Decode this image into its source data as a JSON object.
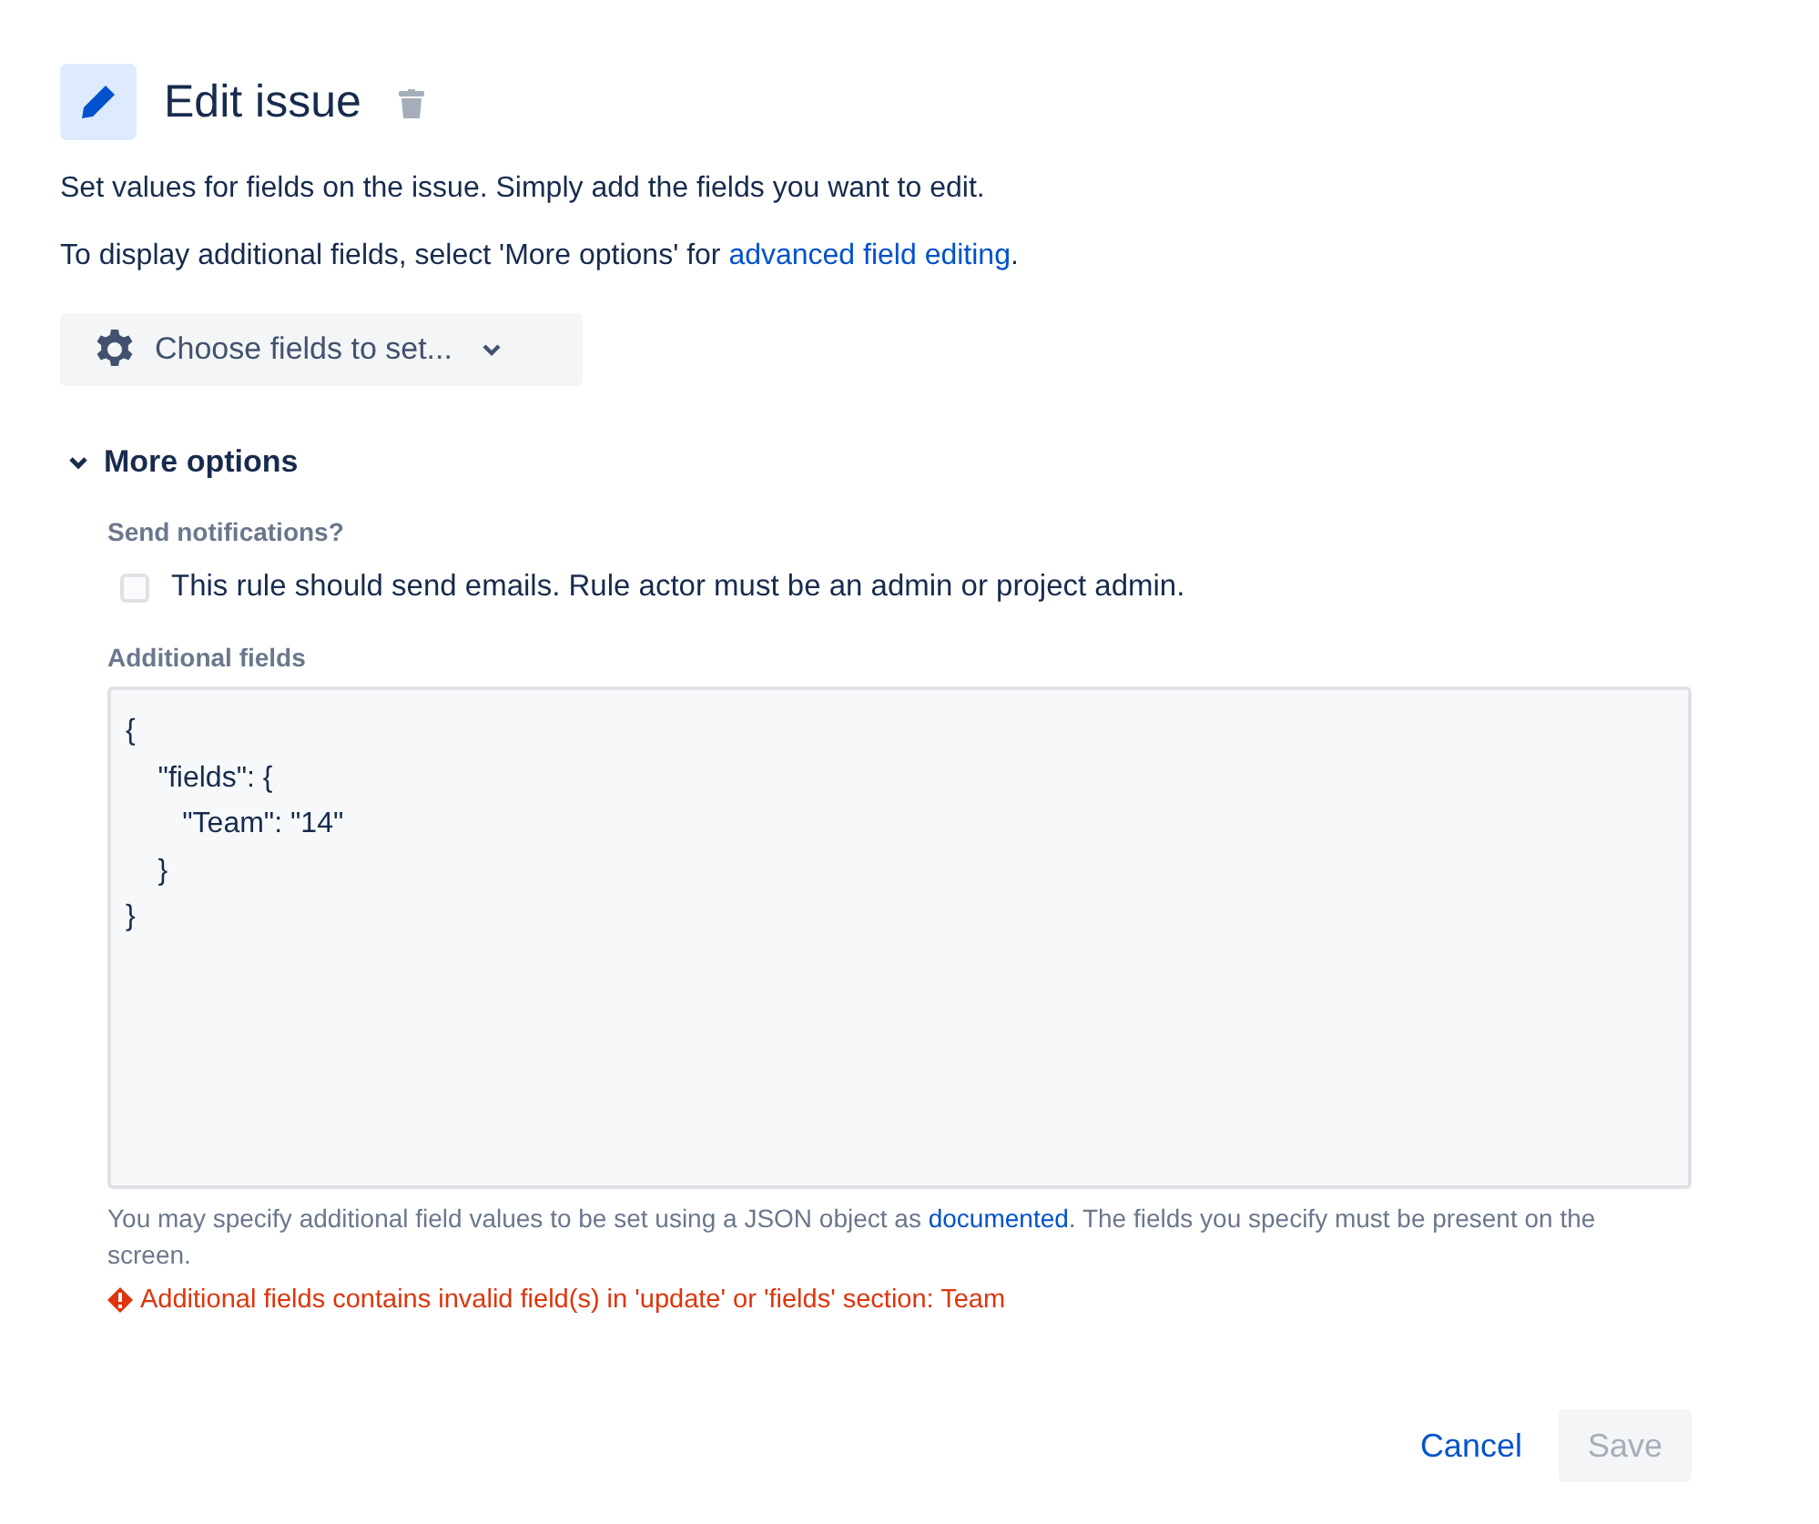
{
  "header": {
    "title": "Edit issue"
  },
  "description": "Set values for fields on the issue. Simply add the fields you want to edit.",
  "advanced_hint": {
    "before": "To display additional fields, select 'More options' for ",
    "link": "advanced field editing",
    "after": "."
  },
  "choose_button": {
    "label": "Choose fields to set..."
  },
  "more_options": {
    "label": "More options",
    "expanded": true,
    "notifications": {
      "label": "Send notifications?",
      "checkbox": {
        "label": "This rule should send emails. Rule actor must be an admin or project admin.",
        "checked": false
      }
    },
    "additional_fields": {
      "label": "Additional fields",
      "value": "{\n    \"fields\": {\n       \"Team\": \"14\"\n    }\n}",
      "help": {
        "before": "You may specify additional field values to be set using a JSON object as ",
        "link": "documented",
        "after": ". The fields you specify must be present on the screen."
      },
      "error": "Additional fields contains invalid field(s) in 'update' or 'fields' section: Team"
    }
  },
  "buttons": [
    {
      "label": "Cancel",
      "kind": "link",
      "disabled": false
    },
    {
      "label": "Save",
      "kind": "primary",
      "disabled": true
    }
  ]
}
